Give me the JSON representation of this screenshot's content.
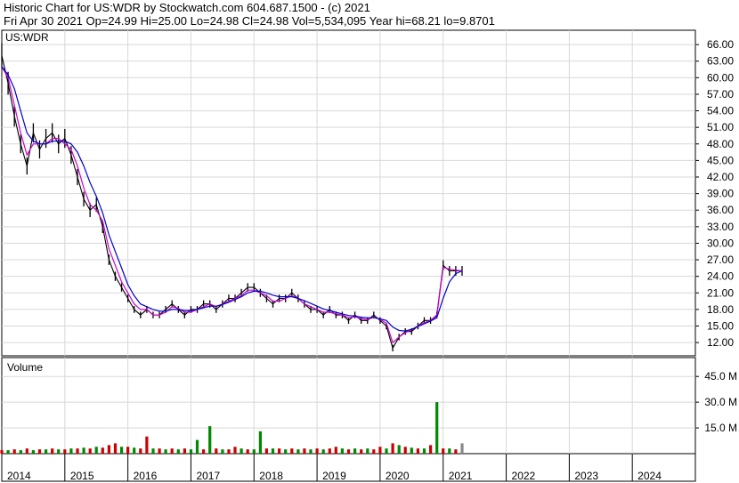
{
  "header": {
    "title": "Historic Chart for US:WDR by Stockwatch.com 604.687.1500 - (c) 2021",
    "quote": "Fri Apr 30 2021   Op=24.99   Hi=25.00   Lo=24.98   Cl=24.98   Vol=5,534,095   Year hi=68.21   lo=9.8701"
  },
  "chart_data": [
    {
      "type": "line",
      "label": "US:WDR",
      "x_ticks": [
        "2014",
        "2015",
        "2016",
        "2017",
        "2018",
        "2019",
        "2020",
        "2021",
        "2022",
        "2023",
        "2024"
      ],
      "y_ticks": [
        "66.00",
        "63.00",
        "60.00",
        "57.00",
        "54.00",
        "51.00",
        "48.00",
        "45.00",
        "42.00",
        "39.00",
        "36.00",
        "33.00",
        "30.00",
        "27.00",
        "24.00",
        "21.00",
        "18.00",
        "15.00",
        "12.00"
      ],
      "ylim": [
        9.6,
        68.6
      ],
      "grid": true,
      "x": [
        2014.0,
        2014.1,
        2014.2,
        2014.3,
        2014.4,
        2014.5,
        2014.6,
        2014.7,
        2014.8,
        2014.9,
        2015.0,
        2015.1,
        2015.2,
        2015.3,
        2015.4,
        2015.5,
        2015.6,
        2015.7,
        2015.8,
        2015.9,
        2016.0,
        2016.1,
        2016.2,
        2016.3,
        2016.4,
        2016.5,
        2016.6,
        2016.7,
        2016.8,
        2016.9,
        2017.0,
        2017.1,
        2017.2,
        2017.3,
        2017.4,
        2017.5,
        2017.6,
        2017.7,
        2017.8,
        2017.9,
        2018.0,
        2018.1,
        2018.2,
        2018.3,
        2018.4,
        2018.5,
        2018.6,
        2018.7,
        2018.8,
        2018.9,
        2019.0,
        2019.1,
        2019.2,
        2019.3,
        2019.4,
        2019.5,
        2019.6,
        2019.7,
        2019.8,
        2019.9,
        2020.0,
        2020.1,
        2020.2,
        2020.3,
        2020.4,
        2020.5,
        2020.6,
        2020.7,
        2020.8,
        2020.9,
        2021.0,
        2021.1,
        2021.2,
        2021.3
      ],
      "series": [
        {
          "name": "price",
          "values": [
            64,
            59,
            53,
            48,
            44,
            50,
            47,
            49,
            50,
            48,
            49,
            46,
            42,
            38,
            36,
            37,
            33,
            27,
            24,
            22,
            20,
            18,
            17,
            18,
            17,
            17,
            18,
            19,
            18,
            17,
            18,
            18,
            19,
            19,
            18,
            19,
            20,
            20,
            21,
            22,
            22,
            21,
            20,
            19,
            20,
            20,
            21,
            20,
            19,
            18,
            18,
            17,
            18,
            17,
            17,
            16,
            17,
            16,
            16,
            17,
            16,
            15,
            11,
            13,
            14,
            14,
            15,
            16,
            16,
            17,
            26,
            25,
            25,
            25
          ],
          "color": "#000000"
        },
        {
          "name": "short-ma",
          "values": [
            62,
            60,
            55,
            50,
            46,
            48,
            48,
            48,
            49,
            49,
            48,
            47,
            44,
            40,
            37,
            36,
            34,
            29,
            26,
            23,
            21,
            19,
            18,
            18,
            17,
            17,
            17.5,
            18.5,
            18.2,
            17.5,
            17.5,
            18,
            18.5,
            19,
            18.5,
            19,
            19.5,
            20,
            20.5,
            21.5,
            21.5,
            21,
            20.5,
            19.5,
            19.5,
            20,
            20.5,
            20,
            19,
            18.5,
            18,
            17.5,
            17.5,
            17.2,
            17,
            16.5,
            16.7,
            16.3,
            16.2,
            16.6,
            16.2,
            15.5,
            12,
            13,
            13.8,
            14.3,
            15,
            15.6,
            16,
            16.8,
            25.6,
            25.3,
            25.1,
            25
          ],
          "color": "#cc00cc"
        },
        {
          "name": "long-ma",
          "values": [
            62,
            60.5,
            58,
            54,
            50,
            48.5,
            48,
            48,
            48.5,
            48.5,
            48.5,
            48,
            46.5,
            44,
            41,
            38.5,
            35.5,
            31.5,
            28.5,
            25.5,
            22.5,
            20.5,
            19,
            18.5,
            18,
            17.7,
            17.7,
            18,
            18,
            17.8,
            17.8,
            18,
            18.3,
            18.6,
            18.6,
            18.9,
            19.3,
            19.8,
            20.3,
            21,
            21.3,
            21.3,
            21,
            20.6,
            20.3,
            20.3,
            20.3,
            20,
            19.6,
            19.1,
            18.6,
            18.1,
            17.8,
            17.5,
            17.2,
            16.9,
            16.8,
            16.6,
            16.5,
            16.5,
            16.3,
            16,
            14.8,
            14.2,
            14.1,
            14.4,
            14.9,
            15.4,
            15.9,
            16.5,
            20,
            23,
            24.5,
            25
          ],
          "color": "#0000cc"
        }
      ]
    },
    {
      "type": "bar",
      "label": "Volume",
      "y_ticks": [
        "45.0 M",
        "30.0 M",
        "15.0 M"
      ],
      "ylim": [
        0,
        56
      ],
      "grid": true,
      "x": [
        2014.0,
        2014.1,
        2014.2,
        2014.3,
        2014.4,
        2014.5,
        2014.6,
        2014.7,
        2014.8,
        2014.9,
        2015.0,
        2015.1,
        2015.2,
        2015.3,
        2015.4,
        2015.5,
        2015.6,
        2015.7,
        2015.8,
        2015.9,
        2016.0,
        2016.1,
        2016.2,
        2016.3,
        2016.4,
        2016.5,
        2016.6,
        2016.7,
        2016.8,
        2016.9,
        2017.0,
        2017.1,
        2017.2,
        2017.3,
        2017.4,
        2017.5,
        2017.6,
        2017.7,
        2017.8,
        2017.9,
        2018.0,
        2018.1,
        2018.2,
        2018.3,
        2018.4,
        2018.5,
        2018.6,
        2018.7,
        2018.8,
        2018.9,
        2019.0,
        2019.1,
        2019.2,
        2019.3,
        2019.4,
        2019.5,
        2019.6,
        2019.7,
        2019.8,
        2019.9,
        2020.0,
        2020.1,
        2020.2,
        2020.3,
        2020.4,
        2020.5,
        2020.6,
        2020.7,
        2020.8,
        2020.9,
        2021.0,
        2021.1,
        2021.2,
        2021.3
      ],
      "values": [
        2,
        2,
        2.5,
        2,
        3,
        2,
        2.5,
        2.5,
        3,
        2.5,
        2.5,
        3,
        3,
        3.5,
        3,
        4,
        3.5,
        5,
        6,
        4,
        4,
        3.5,
        3,
        10,
        3,
        3,
        2.5,
        3,
        2.5,
        3,
        2.5,
        8,
        2.5,
        16,
        3,
        2.5,
        2.5,
        4,
        3,
        2.5,
        2.5,
        13,
        3,
        3,
        3,
        2.5,
        3,
        2.5,
        3,
        2.5,
        3,
        2.5,
        3,
        4,
        3,
        2.5,
        3,
        2.5,
        3,
        2.5,
        4,
        3,
        6,
        5,
        4,
        3.5,
        3,
        3,
        5,
        30,
        3,
        3,
        2.5,
        6
      ],
      "colors": [
        "#cc0000",
        "#008800",
        "#cc0000",
        "#008800",
        "#cc0000",
        "#008800",
        "#cc0000",
        "#008800",
        "#cc0000",
        "#008800",
        "#cc0000",
        "#008800",
        "#cc0000",
        "#008800",
        "#cc0000",
        "#008800",
        "#cc0000",
        "#cc0000",
        "#cc0000",
        "#008800",
        "#cc0000",
        "#008800",
        "#cc0000",
        "#cc0000",
        "#008800",
        "#cc0000",
        "#008800",
        "#cc0000",
        "#008800",
        "#cc0000",
        "#008800",
        "#008800",
        "#cc0000",
        "#008800",
        "#cc0000",
        "#008800",
        "#cc0000",
        "#cc0000",
        "#008800",
        "#cc0000",
        "#008800",
        "#008800",
        "#cc0000",
        "#008800",
        "#cc0000",
        "#008800",
        "#cc0000",
        "#008800",
        "#cc0000",
        "#008800",
        "#cc0000",
        "#008800",
        "#cc0000",
        "#cc0000",
        "#008800",
        "#cc0000",
        "#008800",
        "#cc0000",
        "#008800",
        "#cc0000",
        "#cc0000",
        "#008800",
        "#cc0000",
        "#008800",
        "#cc0000",
        "#008800",
        "#cc0000",
        "#008800",
        "#cc0000",
        "#008800",
        "#cc0000",
        "#008800",
        "#cc0000",
        "#888888"
      ]
    }
  ]
}
